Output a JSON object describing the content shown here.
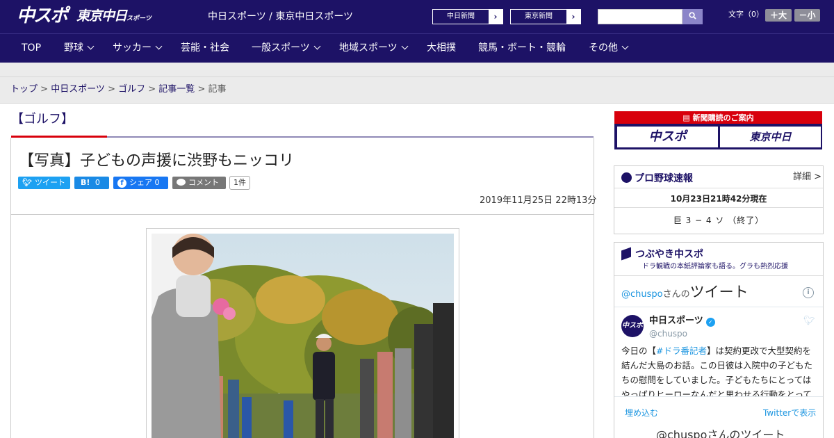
{
  "header": {
    "logo_primary": "中スポ",
    "logo_secondary": "東京中日",
    "logo_secondary_small": "スポーツ",
    "site_title": "中日スポーツ / 東京中日スポーツ",
    "links": [
      {
        "label": "中日新聞"
      },
      {
        "label": "東京新聞"
      }
    ],
    "search": {
      "value": "",
      "placeholder": ""
    },
    "font_size_label": "文字（0）",
    "font_up_label": "＋大",
    "font_down_label": "－小"
  },
  "nav": {
    "items": [
      {
        "label": "TOP",
        "has_menu": false
      },
      {
        "label": "野球",
        "has_menu": true
      },
      {
        "label": "サッカー",
        "has_menu": true
      },
      {
        "label": "芸能・社会",
        "has_menu": false
      },
      {
        "label": "一般スポーツ",
        "has_menu": true
      },
      {
        "label": "地域スポーツ",
        "has_menu": true
      },
      {
        "label": "大相撲",
        "has_menu": false
      },
      {
        "label": "競馬・ボート・競輪",
        "has_menu": false
      },
      {
        "label": "その他",
        "has_menu": true
      }
    ]
  },
  "breadcrumb": {
    "items": [
      "トップ",
      "中日スポーツ",
      "ゴルフ",
      "記事一覧"
    ],
    "current": "記事",
    "separator": " > "
  },
  "article": {
    "category": "【ゴルフ】",
    "headline": "【写真】子どもの声援に渋野もニッコリ",
    "share": {
      "tweet_label": "ツイート",
      "hatena_label": "B!",
      "hatena_count": "0",
      "facebook_label": "シェア",
      "facebook_count": "0",
      "comment_label": "コメント",
      "comment_count": "1件"
    },
    "published": "2019年11月25日 22時13分"
  },
  "sidebar": {
    "subscribe": {
      "title": "新聞購読のご案内",
      "logo1": "中スポ",
      "logo2": "東京中日"
    },
    "baseball": {
      "title": "プロ野球速報",
      "more_label": "詳細 >",
      "as_of": "10月23日21時42分現在",
      "score": "巨 3 − 4 ソ （終了）"
    },
    "tweets": {
      "title": "つぶやき中スポ",
      "subtitle": "ドラ観戦の本紙評論家も語る。グラも熱烈応援",
      "header_handle": "@chuspo",
      "header_suffix": "さんの",
      "header_main": "ツイート",
      "account_name": "中日スポーツ",
      "account_handle": "@chuspo",
      "tweet_prefix": "今日の【",
      "tweet_hashtag": "#ドラ番記者",
      "tweet_body": "】は契約更改で大型契約を結んだ大島のお話。この日彼は入院中の子どもたちの慰問をしていました。子どもたちにとってはやっぱりヒーローなんだと思わせる行動をとっていまし",
      "embed_label": "埋め込む",
      "view_label": "Twitterで表示",
      "bottom_label": "@chuspoさんのツイート"
    }
  },
  "colors": {
    "brand_navy": "#1d1266",
    "accent_red": "#d8000c",
    "twitter_blue": "#1da1f2",
    "facebook_blue": "#1877f2"
  }
}
